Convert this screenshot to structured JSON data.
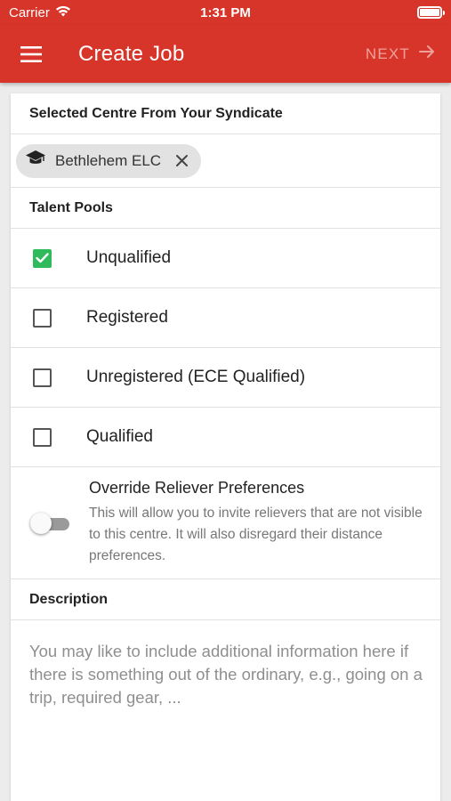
{
  "status_bar": {
    "carrier": "Carrier",
    "time": "1:31 PM"
  },
  "app_bar": {
    "title": "Create Job",
    "next_label": "NEXT",
    "background": "#d8352a"
  },
  "selected_centre": {
    "header": "Selected Centre From Your Syndicate",
    "chip_label": "Bethlehem ELC",
    "chip_icon": "graduation-cap-icon"
  },
  "talent_pools": {
    "header": "Talent Pools",
    "items": [
      {
        "label": "Unqualified",
        "checked": true
      },
      {
        "label": "Registered",
        "checked": false
      },
      {
        "label": "Unregistered (ECE Qualified)",
        "checked": false
      },
      {
        "label": "Qualified",
        "checked": false
      }
    ],
    "check_color": "#2fba5b"
  },
  "override": {
    "title": "Override Reliever Preferences",
    "description": "This will allow you to invite relievers that are not visible to this centre. It will also disregard their distance preferences.",
    "enabled": false
  },
  "description": {
    "header": "Description",
    "placeholder": "You may like to include additional information here if there is something out of the ordinary, e.g., going on a trip, required gear, ..."
  }
}
